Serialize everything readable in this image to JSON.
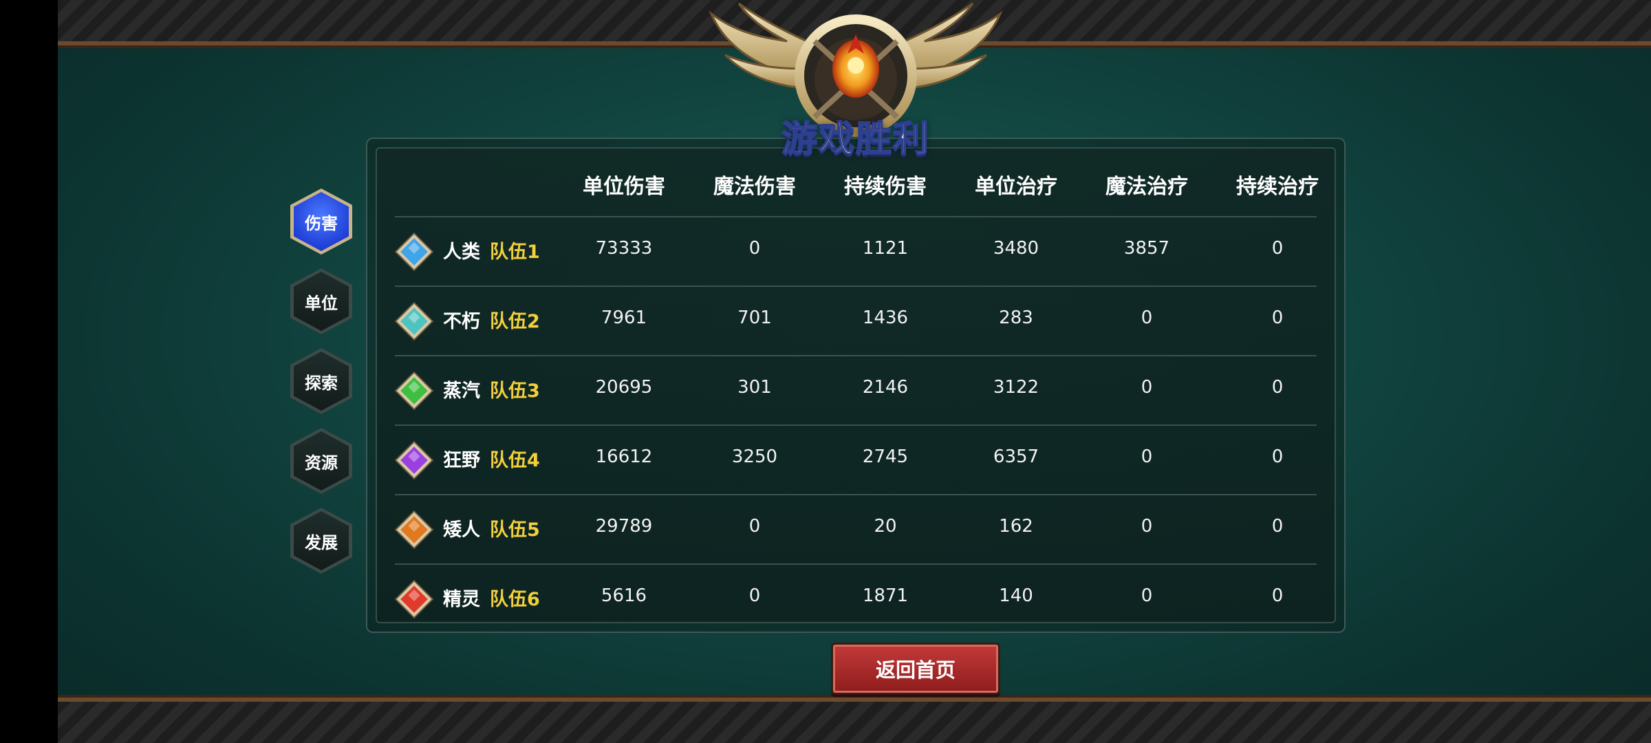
{
  "banner": {
    "title": "游戏胜利"
  },
  "tabs": [
    {
      "label": "伤害",
      "active": true
    },
    {
      "label": "单位",
      "active": false
    },
    {
      "label": "探索",
      "active": false
    },
    {
      "label": "资源",
      "active": false
    },
    {
      "label": "发展",
      "active": false
    }
  ],
  "table": {
    "columns": [
      "单位伤害",
      "魔法伤害",
      "持续伤害",
      "单位治疗",
      "魔法治疗",
      "持续治疗"
    ],
    "rows": [
      {
        "race": "人类",
        "team": "队伍1",
        "gem_color": "#3fa4e8",
        "values": [
          "73333",
          "0",
          "1121",
          "3480",
          "3857",
          "0"
        ]
      },
      {
        "race": "不朽",
        "team": "队伍2",
        "gem_color": "#4fc3c0",
        "values": [
          "7961",
          "701",
          "1436",
          "283",
          "0",
          "0"
        ]
      },
      {
        "race": "蒸汽",
        "team": "队伍3",
        "gem_color": "#3fbf3f",
        "values": [
          "20695",
          "301",
          "2146",
          "3122",
          "0",
          "0"
        ]
      },
      {
        "race": "狂野",
        "team": "队伍4",
        "gem_color": "#9a3fe0",
        "values": [
          "16612",
          "3250",
          "2745",
          "6357",
          "0",
          "0"
        ]
      },
      {
        "race": "矮人",
        "team": "队伍5",
        "gem_color": "#e07a1f",
        "values": [
          "29789",
          "0",
          "20",
          "162",
          "0",
          "0"
        ]
      },
      {
        "race": "精灵",
        "team": "队伍6",
        "gem_color": "#e03a2a",
        "values": [
          "5616",
          "0",
          "1871",
          "140",
          "0",
          "0"
        ]
      }
    ]
  },
  "return_button": {
    "label": "返回首页"
  },
  "colors": {
    "team_text": "#f2d03b",
    "active_tab": "#2a4ff0",
    "button": "#b02a2a"
  }
}
